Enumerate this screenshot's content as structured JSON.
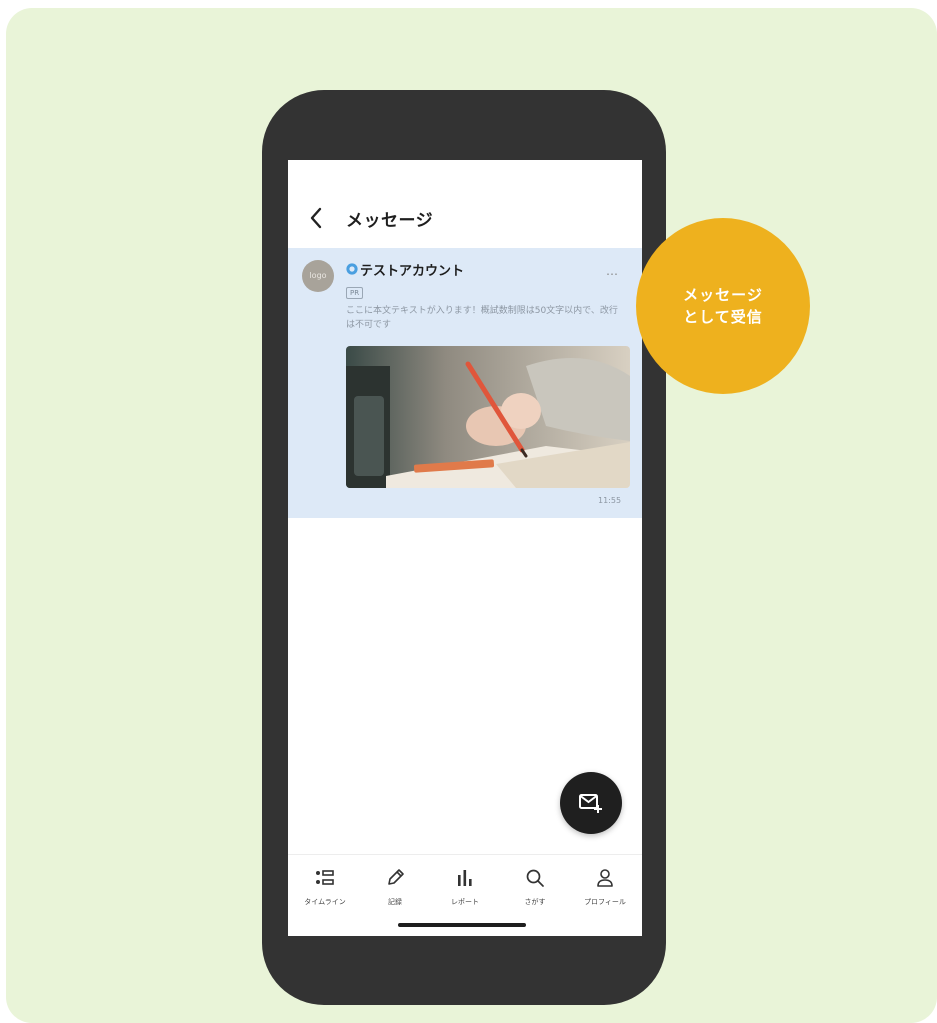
{
  "screen": {
    "title": "メッセージ"
  },
  "message": {
    "avatar_text": "logo",
    "account_name": "テストアカウント",
    "tag": "PR",
    "more": "…",
    "body": "ここに本文テキストが入ります！概試数制限は50文字以内で、改行は不可です",
    "time": "11:55"
  },
  "tabs": [
    {
      "label": "タイムライン",
      "icon": "timeline-icon"
    },
    {
      "label": "記録",
      "icon": "pencil-icon"
    },
    {
      "label": "レポート",
      "icon": "bar-chart-icon"
    },
    {
      "label": "さがす",
      "icon": "search-icon"
    },
    {
      "label": "プロフィール",
      "icon": "profile-icon"
    }
  ],
  "callout": {
    "line1": "メッセージ",
    "line2": "として受信"
  },
  "colors": {
    "background": "#e9f4d8",
    "phone": "#333333",
    "card": "#dde9f7",
    "accent": "#eeb11e",
    "verified": "#4a9fe0"
  }
}
